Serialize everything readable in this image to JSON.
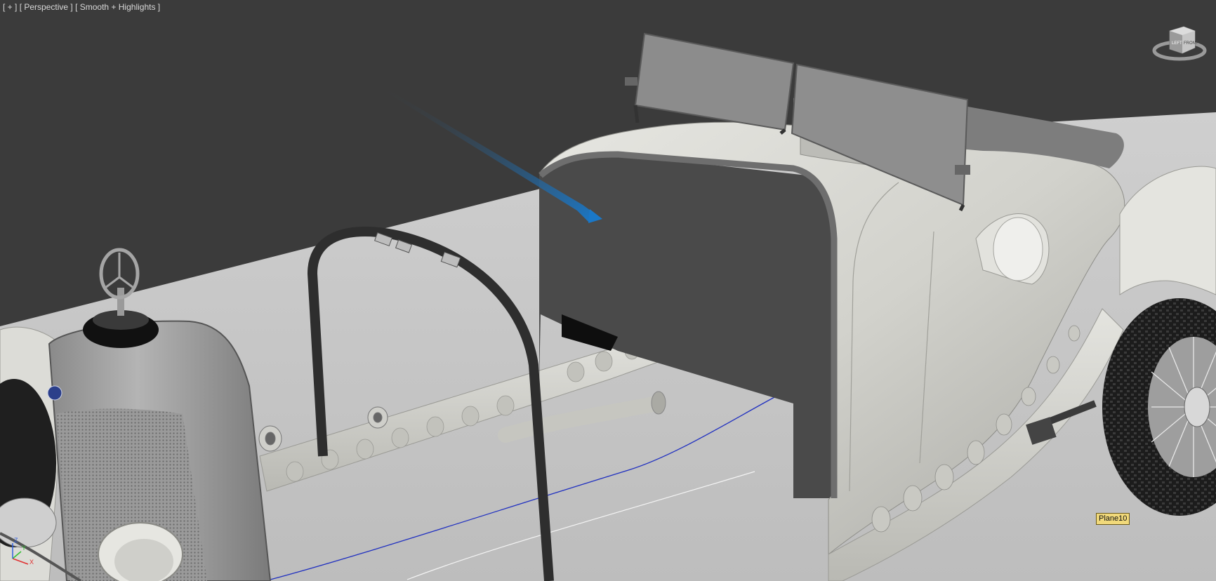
{
  "viewport": {
    "menu_plus": "[ + ]",
    "view_mode": "[ Perspective ]",
    "shading_mode": "[ Smooth + Highlights ]"
  },
  "viewcube": {
    "icon": "viewcube-icon",
    "face_left": "LEFT",
    "face_front": "FRONT"
  },
  "object_tooltip": "Plane10",
  "axis_tripod": {
    "icon": "axis-tripod-icon",
    "x_label": "X",
    "y_label": "Y",
    "z_label": "Z"
  },
  "colors": {
    "background": "#3b3b3b",
    "ground": "#c8c8c8",
    "body": "#d4d4cf",
    "selection_arrow": "#1a78c8",
    "tooltip": "#f1d97a"
  }
}
